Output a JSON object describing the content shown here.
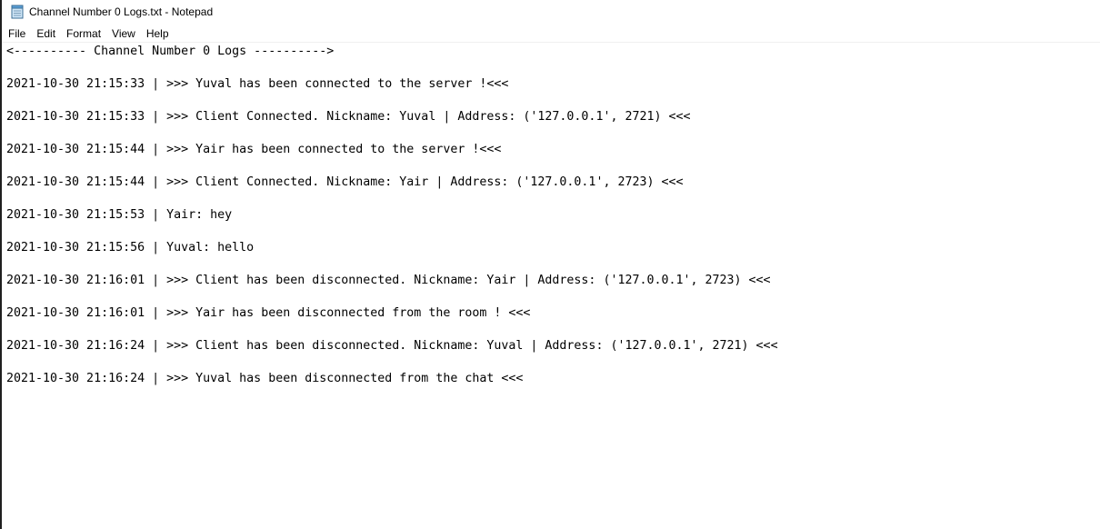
{
  "window": {
    "title": "Channel Number 0 Logs.txt - Notepad",
    "icon": "notepad-icon"
  },
  "menu": [
    "File",
    "Edit",
    "Format",
    "View",
    "Help"
  ],
  "document": {
    "lines": [
      "<---------- Channel Number 0 Logs ---------->",
      "",
      "2021-10-30 21:15:33 | >>> Yuval has been connected to the server !<<<",
      "",
      "2021-10-30 21:15:33 | >>> Client Connected. Nickname: Yuval | Address: ('127.0.0.1', 2721) <<<",
      "",
      "2021-10-30 21:15:44 | >>> Yair has been connected to the server !<<<",
      "",
      "2021-10-30 21:15:44 | >>> Client Connected. Nickname: Yair | Address: ('127.0.0.1', 2723) <<<",
      "",
      "2021-10-30 21:15:53 | Yair: hey",
      "",
      "2021-10-30 21:15:56 | Yuval: hello",
      "",
      "2021-10-30 21:16:01 | >>> Client has been disconnected. Nickname: Yair | Address: ('127.0.0.1', 2723) <<<",
      "",
      "2021-10-30 21:16:01 | >>> Yair has been disconnected from the room ! <<<",
      "",
      "2021-10-30 21:16:24 | >>> Client has been disconnected. Nickname: Yuval | Address: ('127.0.0.1', 2721) <<<",
      "",
      "2021-10-30 21:16:24 | >>> Yuval has been disconnected from the chat <<<"
    ]
  }
}
